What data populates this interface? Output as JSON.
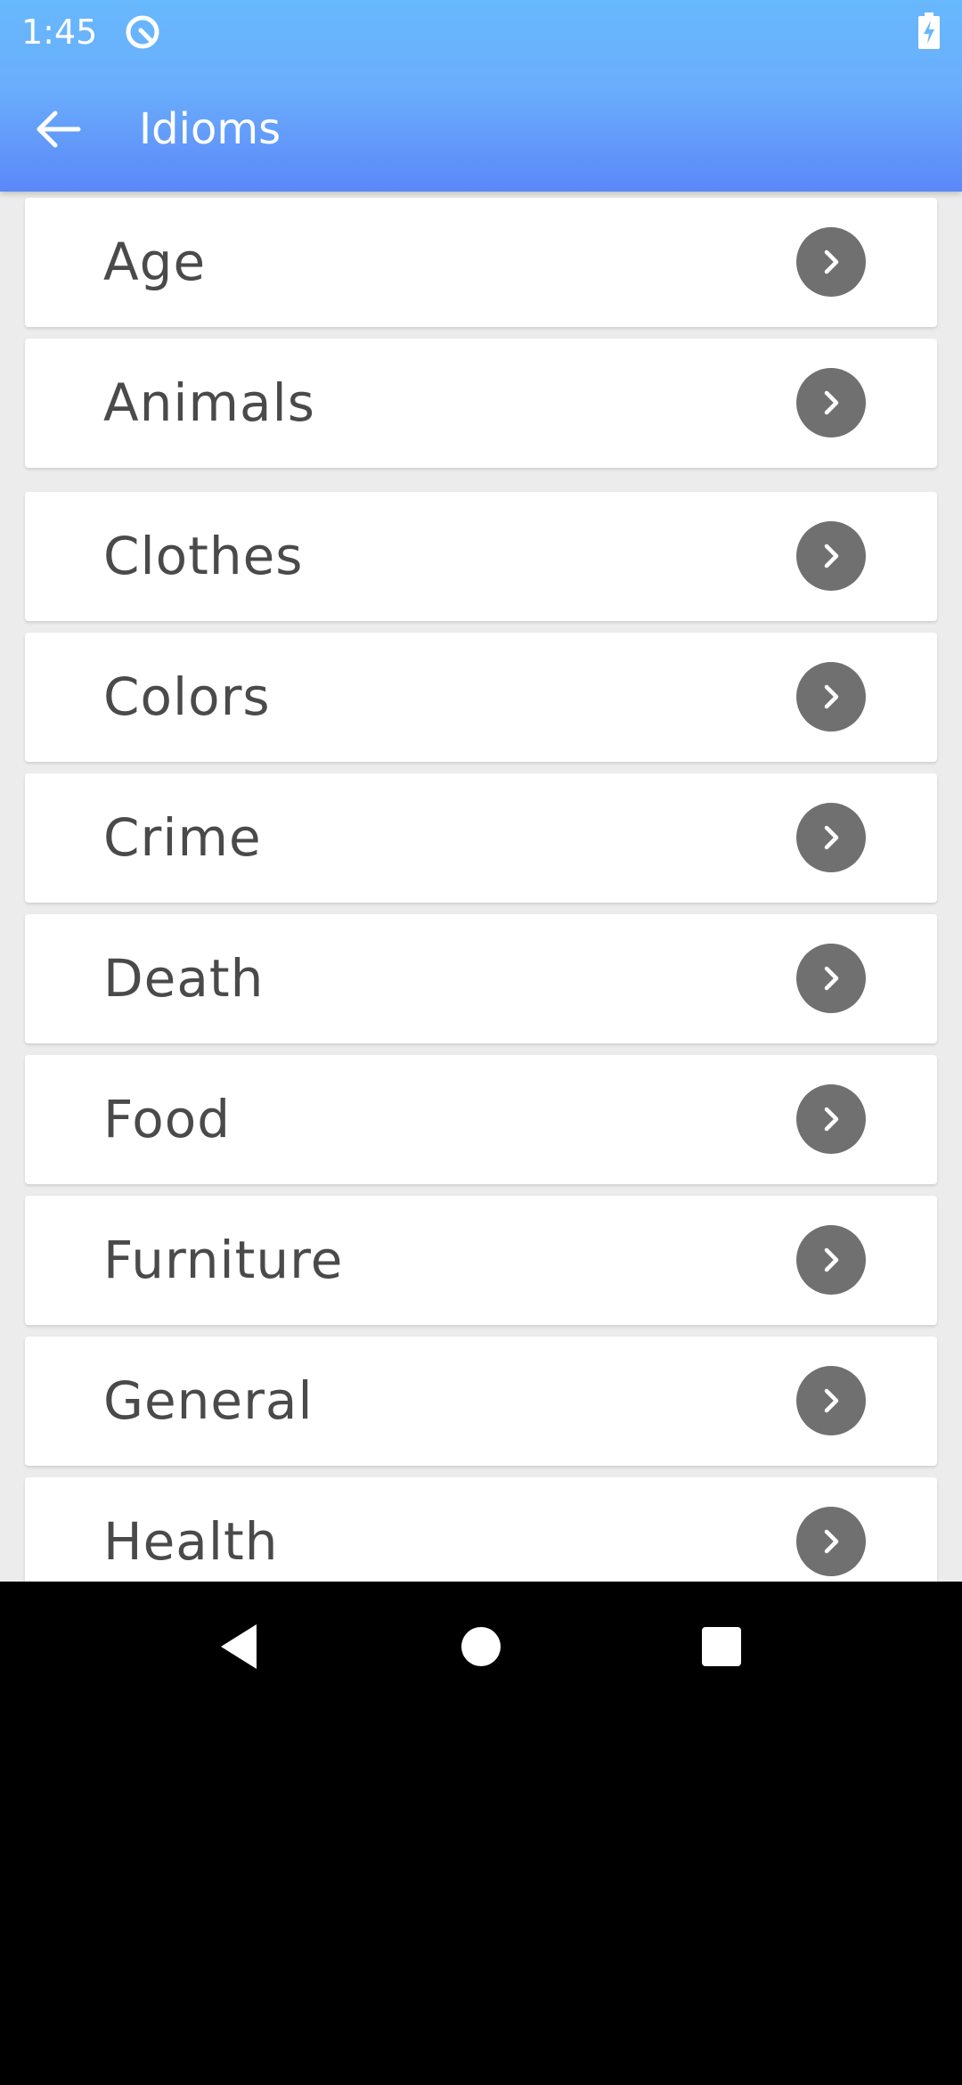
{
  "status_bar": {
    "time": "1:45",
    "icons": [
      "sync-q-icon",
      "battery-charging-icon"
    ]
  },
  "app_bar": {
    "title": "Idioms",
    "back_icon": "arrow-left-icon",
    "gradient_colors": [
      "#67b8fd",
      "#5b88f8"
    ]
  },
  "categories": [
    {
      "label": "Age"
    },
    {
      "label": "Animals"
    },
    {
      "label": "Clothes"
    },
    {
      "label": "Colors"
    },
    {
      "label": "Crime"
    },
    {
      "label": "Death"
    },
    {
      "label": "Food"
    },
    {
      "label": "Furniture"
    },
    {
      "label": "General"
    },
    {
      "label": "Health"
    }
  ],
  "item_icon": "chevron-right-circle-icon",
  "nav_bar": {
    "buttons": [
      "back-triangle-icon",
      "home-circle-icon",
      "recents-square-icon"
    ]
  },
  "colors": {
    "text": "#4a4a4a",
    "chevron_bg": "#707070",
    "background": "#ececec"
  }
}
